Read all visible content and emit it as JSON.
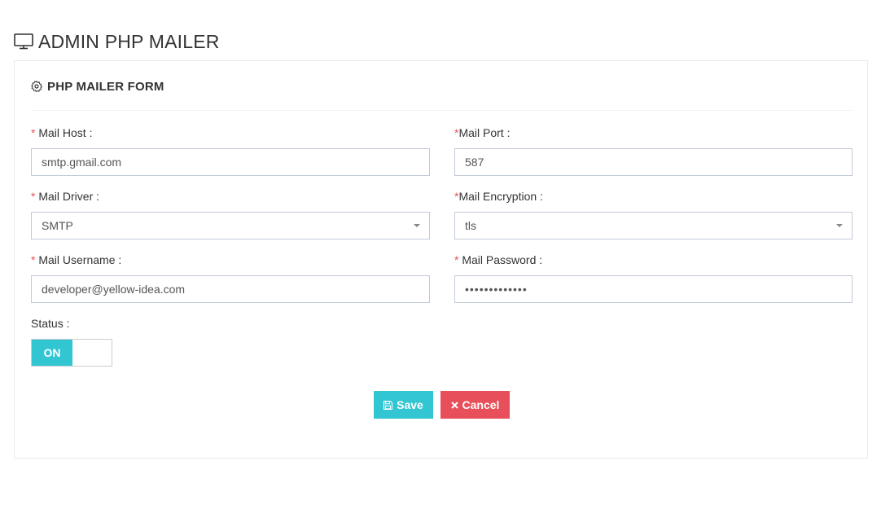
{
  "page": {
    "title": "ADMIN PHP MAILER",
    "title_icon": "monitor-icon"
  },
  "card": {
    "title": "PHP MAILER FORM",
    "title_icon": "gear-icon"
  },
  "form": {
    "required_marker": "*",
    "mail_host": {
      "label": "Mail Host :",
      "value": "smtp.gmail.com"
    },
    "mail_port": {
      "label": "Mail Port :",
      "value": "587"
    },
    "mail_driver": {
      "label": "Mail Driver :",
      "value": "SMTP"
    },
    "mail_encryption": {
      "label": "Mail Encryption :",
      "value": "tls"
    },
    "mail_username": {
      "label": "Mail Username :",
      "value": "developer@yellow-idea.com"
    },
    "mail_password": {
      "label": "Mail Password :",
      "value": "•••••••••••••"
    },
    "status": {
      "label": "Status :",
      "toggle_text": "ON",
      "enabled": true
    }
  },
  "buttons": {
    "save": {
      "label": "Save",
      "icon": "floppy-disk-icon"
    },
    "cancel": {
      "label": "Cancel",
      "icon": "close-icon"
    }
  },
  "colors": {
    "accent": "#32c5d2",
    "danger": "#e7505a",
    "required": "#e7505a",
    "border": "#c2cad8"
  }
}
